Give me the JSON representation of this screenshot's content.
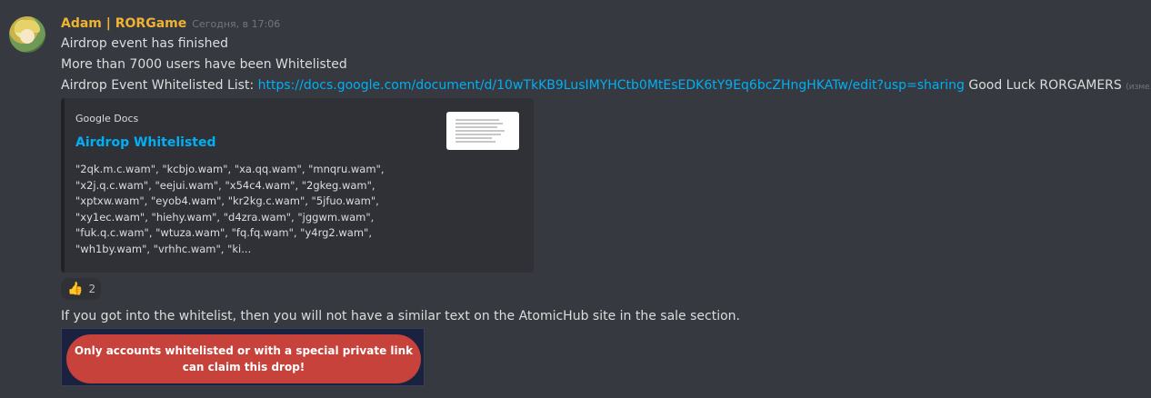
{
  "message": {
    "author": "Adam | RORGame",
    "timestamp": "Сегодня, в 17:06",
    "lines": [
      "Airdrop event has finished",
      "More than 7000 users have been Whitelisted"
    ],
    "whitelist_prefix": "Airdrop Event Whitelisted List: ",
    "whitelist_link": "https://docs.google.com/document/d/10wTkKB9LusIMYHCtb0MtEsEDK6tY9Eq6bcZHngHKATw/edit?usp=sharing",
    "whitelist_suffix": " Good Luck RORGAMERS ",
    "edited_label": "(изме..."
  },
  "embed": {
    "provider": "Google Docs",
    "title": "Airdrop Whitelisted",
    "description": "\"2qk.m.c.wam\", \"kcbjo.wam\", \"xa.qq.wam\", \"mnqru.wam\",\n\"x2j.q.c.wam\", \"eejui.wam\", \"x54c4.wam\", \"2gkeg.wam\",\n\"xptxw.wam\", \"eyob4.wam\", \"kr2kg.c.wam\", \"5jfuo.wam\",\n\"xy1ec.wam\", \"hiehy.wam\", \"d4zra.wam\", \"jggwm.wam\",\n\"fuk.q.c.wam\", \"wtuza.wam\", \"fq.fq.wam\", \"y4rg2.wam\",\n\"wh1by.wam\", \"vrhhc.wam\", \"ki..."
  },
  "reaction": {
    "emoji": "👍",
    "count": "2"
  },
  "followup": "If you got into the whitelist, then you will not have a similar text on the AtomicHub site in the sale section.",
  "attachment_text": "Only accounts whitelisted or with a special private link can claim this drop!"
}
